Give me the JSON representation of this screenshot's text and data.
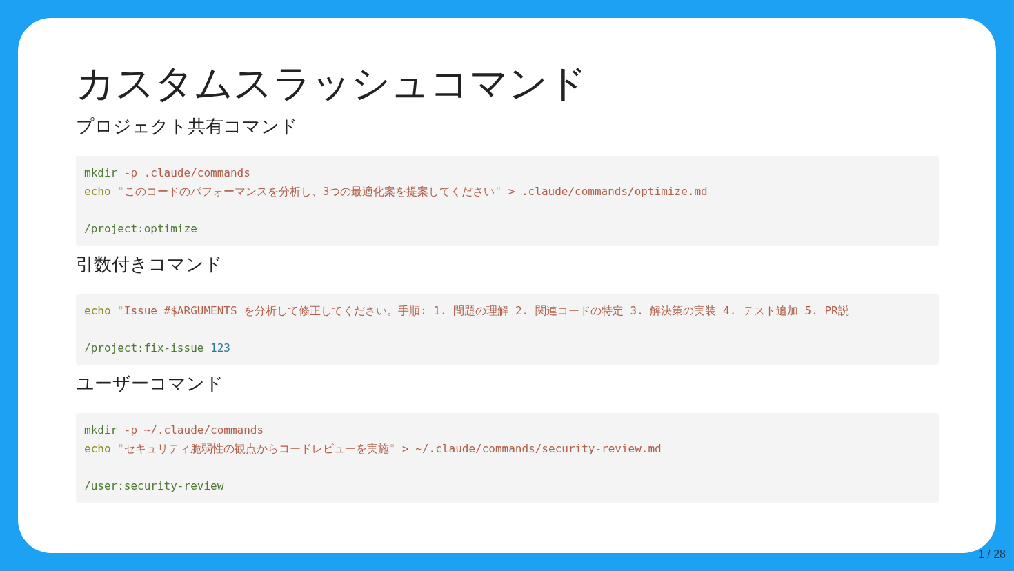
{
  "slide": {
    "title": "カスタムスラッシュコマンド",
    "sections": [
      {
        "heading": "プロジェクト共有コマンド",
        "lines": [
          {
            "kind": "code",
            "tokens": [
              {
                "kind": "command",
                "text": "mkdir"
              },
              {
                "kind": "string",
                "text": " -p .claude/commands"
              }
            ]
          },
          {
            "kind": "code",
            "tokens": [
              {
                "kind": "builtin",
                "text": "echo"
              },
              {
                "kind": "quote",
                "text": " \""
              },
              {
                "kind": "string",
                "text": "このコードのパフォーマンスを分析し、3つの最適化案を提案してください"
              },
              {
                "kind": "quote",
                "text": "\""
              },
              {
                "kind": "string",
                "text": " > .claude/commands/optimize.md"
              }
            ]
          },
          {
            "kind": "blank"
          },
          {
            "kind": "code",
            "tokens": [
              {
                "kind": "command",
                "text": "/project:optimize"
              }
            ]
          }
        ]
      },
      {
        "heading": "引数付きコマンド",
        "lines": [
          {
            "kind": "code",
            "tokens": [
              {
                "kind": "builtin",
                "text": "echo"
              },
              {
                "kind": "quote",
                "text": " \""
              },
              {
                "kind": "string",
                "text": "Issue #$ARGUMENTS を分析して修正してください。手順: 1. 問題の理解 2. 関連コードの特定 3. 解決策の実装 4. テスト追加 5. PR説"
              }
            ]
          },
          {
            "kind": "blank"
          },
          {
            "kind": "code",
            "tokens": [
              {
                "kind": "command",
                "text": "/project:fix-issue"
              },
              {
                "kind": "number",
                "text": " 123"
              }
            ]
          }
        ]
      },
      {
        "heading": "ユーザーコマンド",
        "lines": [
          {
            "kind": "code",
            "tokens": [
              {
                "kind": "command",
                "text": "mkdir"
              },
              {
                "kind": "string",
                "text": " -p ~/.claude/commands"
              }
            ]
          },
          {
            "kind": "code",
            "tokens": [
              {
                "kind": "builtin",
                "text": "echo"
              },
              {
                "kind": "quote",
                "text": " \""
              },
              {
                "kind": "string",
                "text": "セキュリティ脆弱性の観点からコードレビューを実施"
              },
              {
                "kind": "quote",
                "text": "\""
              },
              {
                "kind": "string",
                "text": " > ~/.claude/commands/security-review.md"
              }
            ]
          },
          {
            "kind": "blank"
          },
          {
            "kind": "code",
            "tokens": [
              {
                "kind": "command",
                "text": "/user:security-review"
              }
            ]
          }
        ]
      }
    ]
  },
  "page_counter": "1 / 28"
}
